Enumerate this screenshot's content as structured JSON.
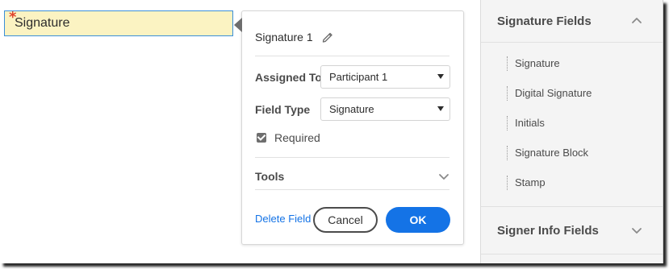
{
  "document": {
    "field_required_marker": "*",
    "field_label": "Signature"
  },
  "popover": {
    "title": "Signature 1",
    "assigned_to_label": "Assigned To",
    "assigned_to_value": "Participant 1",
    "field_type_label": "Field Type",
    "field_type_value": "Signature",
    "required_label": "Required",
    "required_checked": true,
    "tools_label": "Tools",
    "delete_label": "Delete Field",
    "cancel_label": "Cancel",
    "ok_label": "OK"
  },
  "panel": {
    "signature_fields_header": "Signature Fields",
    "signature_fields_items": [
      "Signature",
      "Digital Signature",
      "Initials",
      "Signature Block",
      "Stamp"
    ],
    "signer_info_header": "Signer Info Fields"
  },
  "colors": {
    "accent": "#1473e6",
    "field_fill": "#fbf3c2",
    "required_star": "#e0442d"
  },
  "icons": {
    "edit": "pencil-icon",
    "expand": "chevron-down-icon",
    "collapse": "chevron-up-icon"
  }
}
